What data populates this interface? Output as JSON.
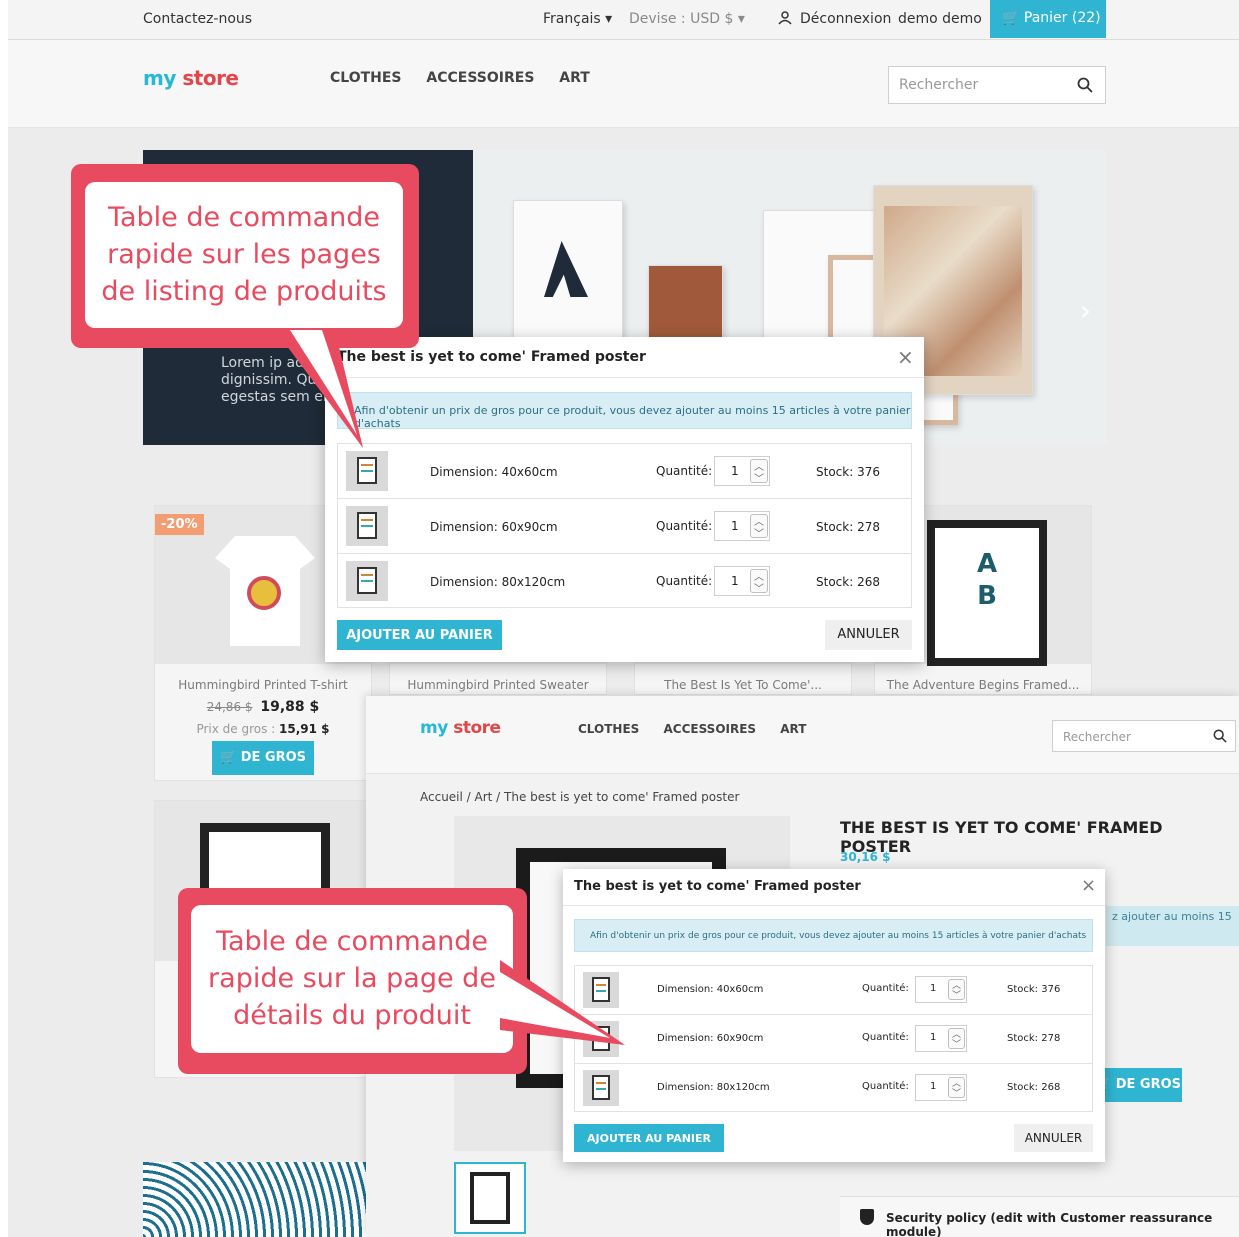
{
  "topbar": {
    "contact": "Contactez-nous",
    "language": "Français",
    "currency": "Devise : USD $",
    "logout": "Déconnexion",
    "user": "demo demo",
    "cart": "Panier (22)"
  },
  "header": {
    "logo_part1": "my",
    "logo_part2": "store",
    "nav": [
      "CLOTHES",
      "ACCESSOIRES",
      "ART"
    ],
    "search_placeholder": "Rechercher"
  },
  "banner": {
    "lorem": "Lorem ip adipiscing dignissim. Qu egestas sem el"
  },
  "products": [
    {
      "name": "Hummingbird Printed T-shirt",
      "badge": "-20%",
      "old_price": "24,86 $",
      "price": "19,88 $",
      "wholesale_label": "Prix de gros :",
      "wholesale_price": "15,91 $",
      "button": "DE GROS"
    },
    {
      "name": "Hummingbird Printed Sweater"
    },
    {
      "name": "The Best Is Yet To Come'..."
    },
    {
      "name": "The Adventure Begins Framed..."
    }
  ],
  "detail": {
    "breadcrumb": "Accueil  /  Art  /  The best is yet to come' Framed poster",
    "title": "THE BEST IS YET TO COME' FRAMED POSTER",
    "price": "30,16 $",
    "info_snippet": "z ajouter au moins 15",
    "degros": "DE GROS",
    "reassurance": "Security policy (edit with Customer reassurance module)"
  },
  "modal": {
    "title": "The best is yet to come' Framed poster",
    "notice": "Afin d'obtenir un prix de gros pour ce produit, vous devez ajouter au moins 15 articles à votre panier d'achats",
    "quantity_label": "Quantité:",
    "rows": [
      {
        "dimension": "Dimension: 40x60cm",
        "quantity": "1",
        "stock": "Stock: 376"
      },
      {
        "dimension": "Dimension: 60x90cm",
        "quantity": "1",
        "stock": "Stock: 278"
      },
      {
        "dimension": "Dimension: 80x120cm",
        "quantity": "1",
        "stock": "Stock: 268"
      }
    ],
    "add_to_cart": "AJOUTER AU PANIER",
    "cancel": "ANNULER"
  },
  "callouts": {
    "listing": [
      "Table de commande",
      "rapide sur les pages",
      "de listing de produits"
    ],
    "detail": [
      "Table de commande",
      "rapide sur la page de",
      "détails du produit"
    ]
  },
  "colors": {
    "accent": "#2fb5d2",
    "callout": "#e84a5f",
    "notice_bg": "#d8eef4"
  }
}
